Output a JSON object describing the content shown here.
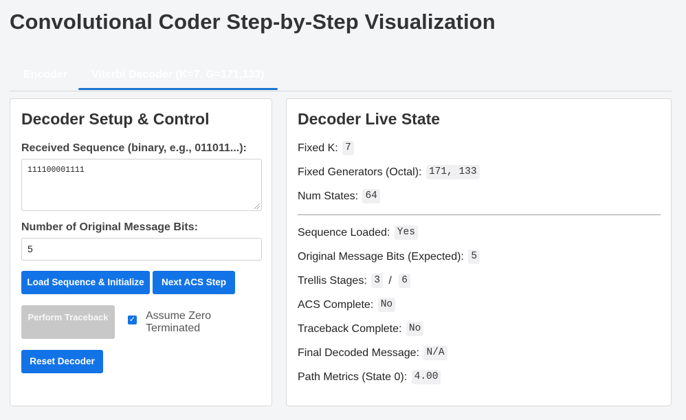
{
  "title": "Convolutional Coder Step-by-Step Visualization",
  "tabs": [
    {
      "label": "Encoder",
      "active": false
    },
    {
      "label": "Viterbi Decoder (K=7, G=171,133)",
      "active": true
    }
  ],
  "setup": {
    "heading": "Decoder Setup & Control",
    "received_label": "Received Sequence (binary, e.g., 011011...):",
    "received_value": "111100001111",
    "msg_bits_label": "Number of Original Message Bits:",
    "msg_bits_value": "5",
    "load_button": "Load Sequence & Initialize",
    "next_button": "Next ACS Step",
    "traceback_button": "Perform Traceback",
    "zero_terminated_label": "Assume Zero Terminated",
    "zero_terminated_checked": true,
    "reset_button": "Reset Decoder"
  },
  "live_state": {
    "heading": "Decoder Live State",
    "fixed_k_label": "Fixed K:",
    "fixed_k_value": "7",
    "generators_label": "Fixed Generators (Octal):",
    "generators_value": "171, 133",
    "num_states_label": "Num States:",
    "num_states_value": "64",
    "seq_loaded_label": "Sequence Loaded:",
    "seq_loaded_value": "Yes",
    "orig_bits_label": "Original Message Bits (Expected):",
    "orig_bits_value": "5",
    "trellis_label": "Trellis Stages:",
    "trellis_current": "3",
    "trellis_sep": "/",
    "trellis_total": "6",
    "acs_label": "ACS Complete:",
    "acs_value": "No",
    "traceback_label": "Traceback Complete:",
    "traceback_value": "No",
    "final_msg_label": "Final Decoded Message:",
    "final_msg_value": "N/A",
    "path_metrics_label": "Path Metrics (State 0):",
    "path_metrics_value": "4.00"
  },
  "colors": {
    "accent": "#1273e6",
    "disabled": "#c8c8c8"
  }
}
